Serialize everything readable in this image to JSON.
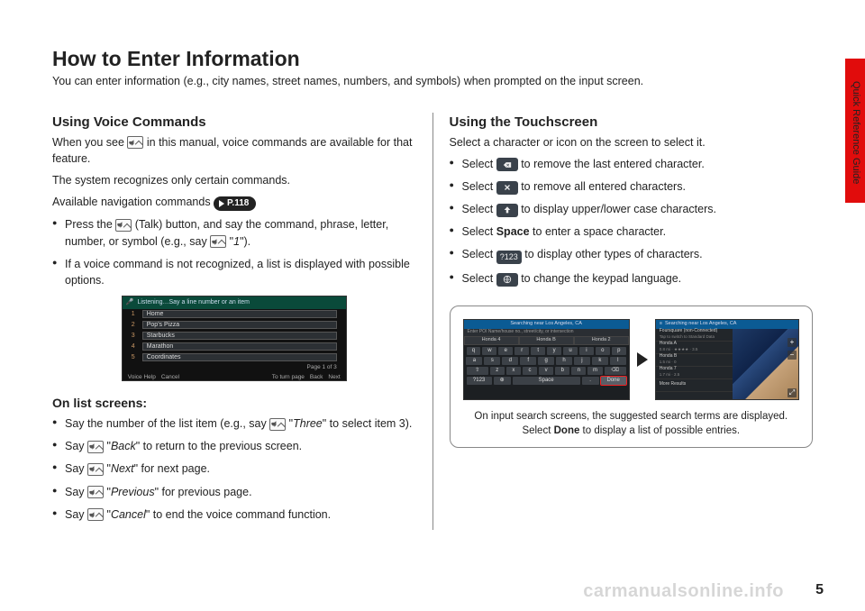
{
  "side_label": "Quick Reference Guide",
  "title": "How to Enter Information",
  "intro": "You can enter information (e.g., city names, street names, numbers, and symbols) when prompted on the input screen.",
  "left": {
    "h_voice": "Using Voice Commands",
    "voice_p1a": "When you see ",
    "voice_p1b": " in this manual, voice commands are available for that feature.",
    "voice_p2": "The system recognizes only certain commands.",
    "voice_p3": "Available navigation commands ",
    "pill": "P.118",
    "bul1a": "Press the ",
    "bul1b": " (Talk) button, and say the command, phrase, letter, number, or symbol (e.g., say ",
    "bul1c": "1",
    "bul1d": ").",
    "bul2": "If a voice command is not recognized, a list is displayed with possible options.",
    "ss": {
      "header": "Listening…Say a line number or an item",
      "items": [
        "Home",
        "Pop's Pizza",
        "Starbucks",
        "Marathon",
        "Coordinates"
      ],
      "page": "Page 1 of 3",
      "bottom": [
        "Voice Help",
        "Cancel",
        "To turn page",
        "Back",
        "Next"
      ]
    },
    "h_list": "On list screens:",
    "lb1a": "Say the number of the list item (e.g., say ",
    "lb1b": "Three",
    "lb1c": " to select item 3).",
    "lb2a": "Say ",
    "lb2b": "Back",
    "lb2c": " to return to the previous screen.",
    "lb3a": "Say ",
    "lb3b": "Next",
    "lb3c": " for next page.",
    "lb4a": "Say ",
    "lb4b": "Previous",
    "lb4c": " for previous page.",
    "lb5a": "Say ",
    "lb5b": "Cancel",
    "lb5c": " to end the voice command function."
  },
  "right": {
    "h_touch": "Using the Touchscreen",
    "touch_p1": "Select a character or icon on the screen to select it.",
    "r1a": "Select ",
    "r1b": " to remove the last entered character.",
    "r2a": "Select ",
    "r2b": " to remove all entered characters.",
    "r3a": "Select ",
    "r3b": " to display upper/lower case characters.",
    "r4a": "Select ",
    "r4b": "Space",
    "r4c": " to enter a space character.",
    "r5a": "Select ",
    "r5label": "?123",
    "r5b": " to display other types of characters.",
    "r6a": "Select ",
    "r6b": " to change the keypad language.",
    "callout": {
      "kb": {
        "header": "Searching near Los Angeles, CA",
        "sub": "Enter POI Name/house no., street/city, or intersection",
        "suggest": [
          "Honda 4",
          "Honda B",
          "Honda 2"
        ],
        "rows": [
          [
            "q",
            "w",
            "e",
            "r",
            "t",
            "y",
            "u",
            "i",
            "o",
            "p"
          ],
          [
            "a",
            "s",
            "d",
            "f",
            "g",
            "h",
            "j",
            "k",
            "l"
          ],
          [
            "⇧",
            "z",
            "x",
            "c",
            "v",
            "b",
            "n",
            "m",
            "⌫"
          ]
        ],
        "row4": [
          "?123",
          "⊕",
          "Space",
          ".",
          "Done"
        ]
      },
      "map": {
        "header": "Searching near Los Angeles, CA",
        "list": [
          {
            "t": "Foursquare (non-Connected)",
            "s": "Tap to switch to Standard Data"
          },
          {
            "t": "Honda A",
            "s": "0.8 mi · ★★★★ · 3.5"
          },
          {
            "t": "Honda B",
            "s": "1.5 mi · 0"
          },
          {
            "t": "Honda 7",
            "s": "1.7 mi · 2.5"
          },
          {
            "t": "More Results",
            "s": ""
          }
        ]
      },
      "caption": "On input search screens, the suggested search terms are displayed. Select Done to display a list of possible entries.",
      "caption_a": "On input search screens, the suggested search terms are displayed. Select ",
      "caption_b": "Done",
      "caption_c": " to display a list of possible entries."
    }
  },
  "page_num": "5",
  "watermark": "carmanualsonline.info"
}
